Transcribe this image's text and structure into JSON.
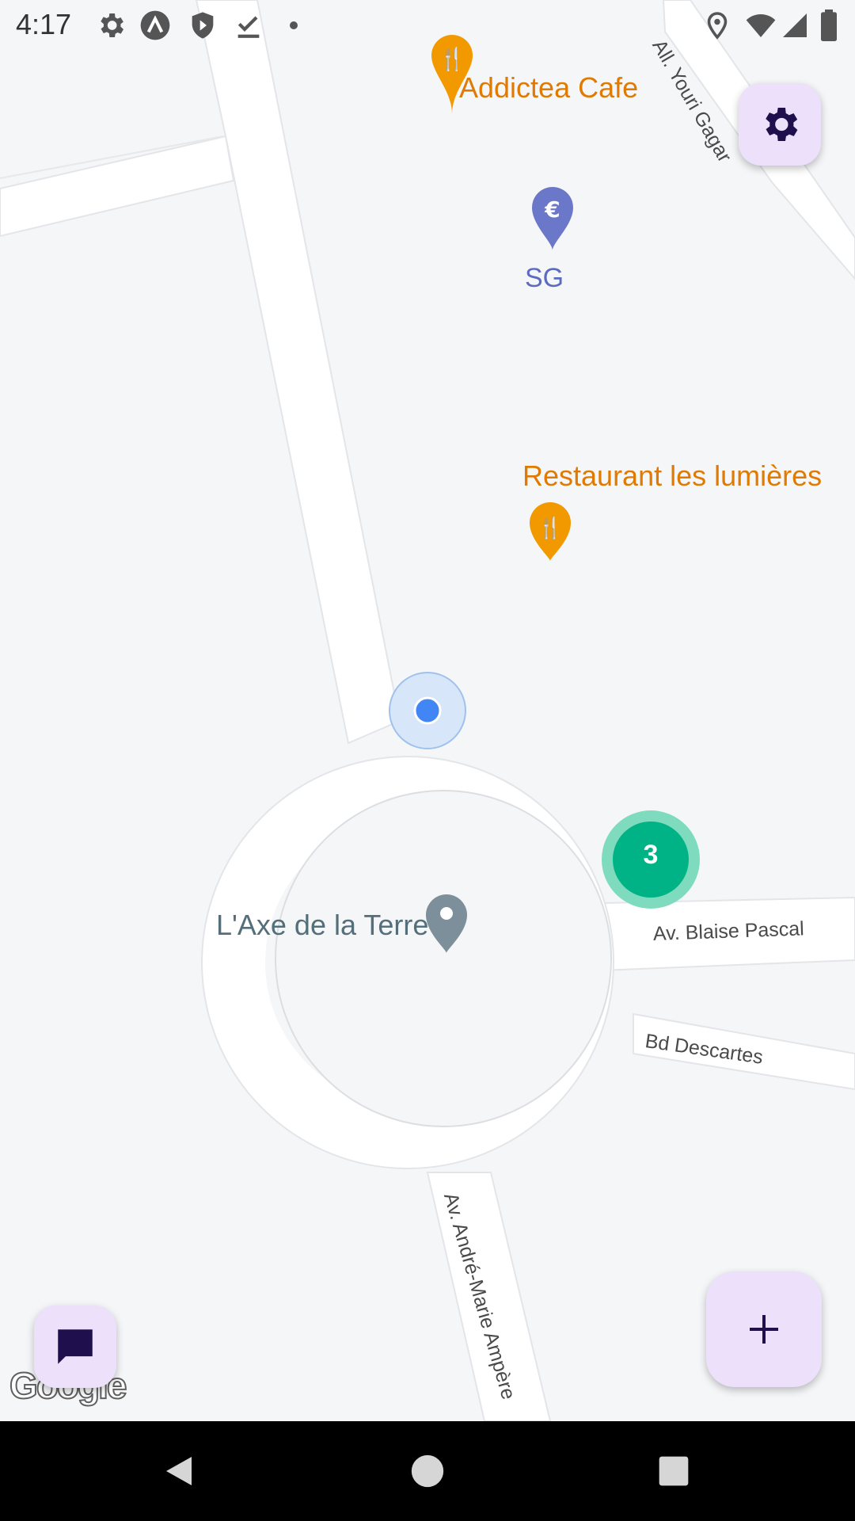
{
  "status_bar": {
    "time": "4:17",
    "left_icons": [
      "settings-icon",
      "a-circle-icon",
      "shield-play-icon",
      "download-done-icon",
      "dot-icon"
    ],
    "right_icons": [
      "location-icon",
      "wifi-icon",
      "signal-icon",
      "battery-icon"
    ]
  },
  "map": {
    "pois": [
      {
        "name": "Addictea Cafe",
        "category": "restaurant",
        "color": "#f29900"
      },
      {
        "name": "SG",
        "category": "bank",
        "color": "#6b78c9"
      },
      {
        "name": "Restaurant les lumières",
        "category": "restaurant",
        "color": "#f29900"
      },
      {
        "name": "L'Axe de la Terre",
        "category": "landmark",
        "color": "#7d8f9b"
      }
    ],
    "streets": [
      "All. Youri Gagar",
      "Av. Blaise Pascal",
      "Bd Descartes",
      "Av. André-Marie Ampère"
    ],
    "cluster": {
      "count": "3",
      "color": "#00b386"
    },
    "user_location": {
      "color": "#4285f4"
    },
    "attribution": "Google"
  },
  "buttons": {
    "settings": {
      "icon": "gear-icon",
      "color": "#ece0fb"
    },
    "add": {
      "icon": "plus-icon",
      "color": "#ece0fb"
    },
    "chat": {
      "icon": "chat-icon",
      "color": "#ece0fb"
    }
  },
  "nav_bar": {
    "items": [
      "back-icon",
      "home-icon",
      "recents-icon"
    ]
  }
}
